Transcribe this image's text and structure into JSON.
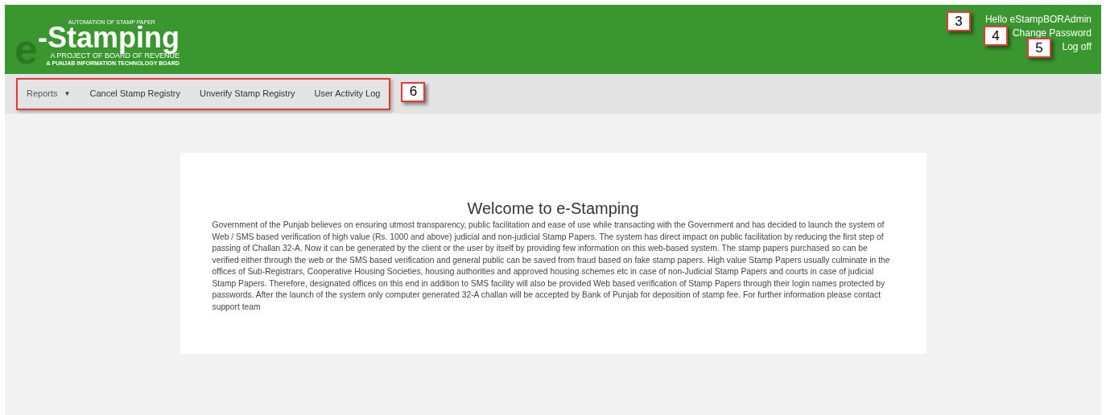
{
  "header": {
    "logo": {
      "tag": "AUTOMATION OF STAMP PAPER",
      "prefix": "e",
      "name": "-Stamping",
      "line1": "A PROJECT OF BOARD OF REVENUE",
      "line2": "& PUNJAB INFORMATION TECHNOLOGY BOARD"
    },
    "user_links": [
      {
        "label": "Hello eStampBORAdmin",
        "callout": "3"
      },
      {
        "label": "Change Password",
        "callout": "4"
      },
      {
        "label": "Log off",
        "callout": "5"
      }
    ]
  },
  "nav": {
    "callout": "6",
    "items": [
      {
        "label": "Reports",
        "kind": "dropdown",
        "caret": "▼"
      },
      {
        "label": "Cancel Stamp Registry",
        "kind": "link"
      },
      {
        "label": "Unverify Stamp Registry",
        "kind": "link"
      },
      {
        "label": "User Activity Log",
        "kind": "link"
      }
    ]
  },
  "welcome": {
    "title": "Welcome to e-Stamping",
    "text": "Government of the Punjab believes on ensuring utmost transparency, public facilitation and ease of use while transacting with the Government and has decided to launch the system of Web / SMS based verification of high value (Rs. 1000 and above) judicial and non-judicial Stamp Papers. The system has direct impact on public facilitation by reducing the first step of passing of Challan 32-A. Now it can be generated by the client or the user by itself by providing few information on this web-based system. The stamp papers purchased so can be verified either through the web or the SMS based verification and general public can be saved from fraud based on fake stamp papers. High value Stamp Papers usually culminate in the offices of Sub-Registrars, Cooperative Housing Societies, housing authorities and approved housing schemes etc in case of non-Judicial Stamp Papers and courts in case of judicial Stamp Papers. Therefore, designated offices on this end in addition to SMS facility will also be provided Web based verification of Stamp Papers through their login names protected by passwords. After the launch of the system only computer generated 32-A challan will be accepted by Bank of Punjab for deposition of stamp fee. For further information please contact support team"
  }
}
